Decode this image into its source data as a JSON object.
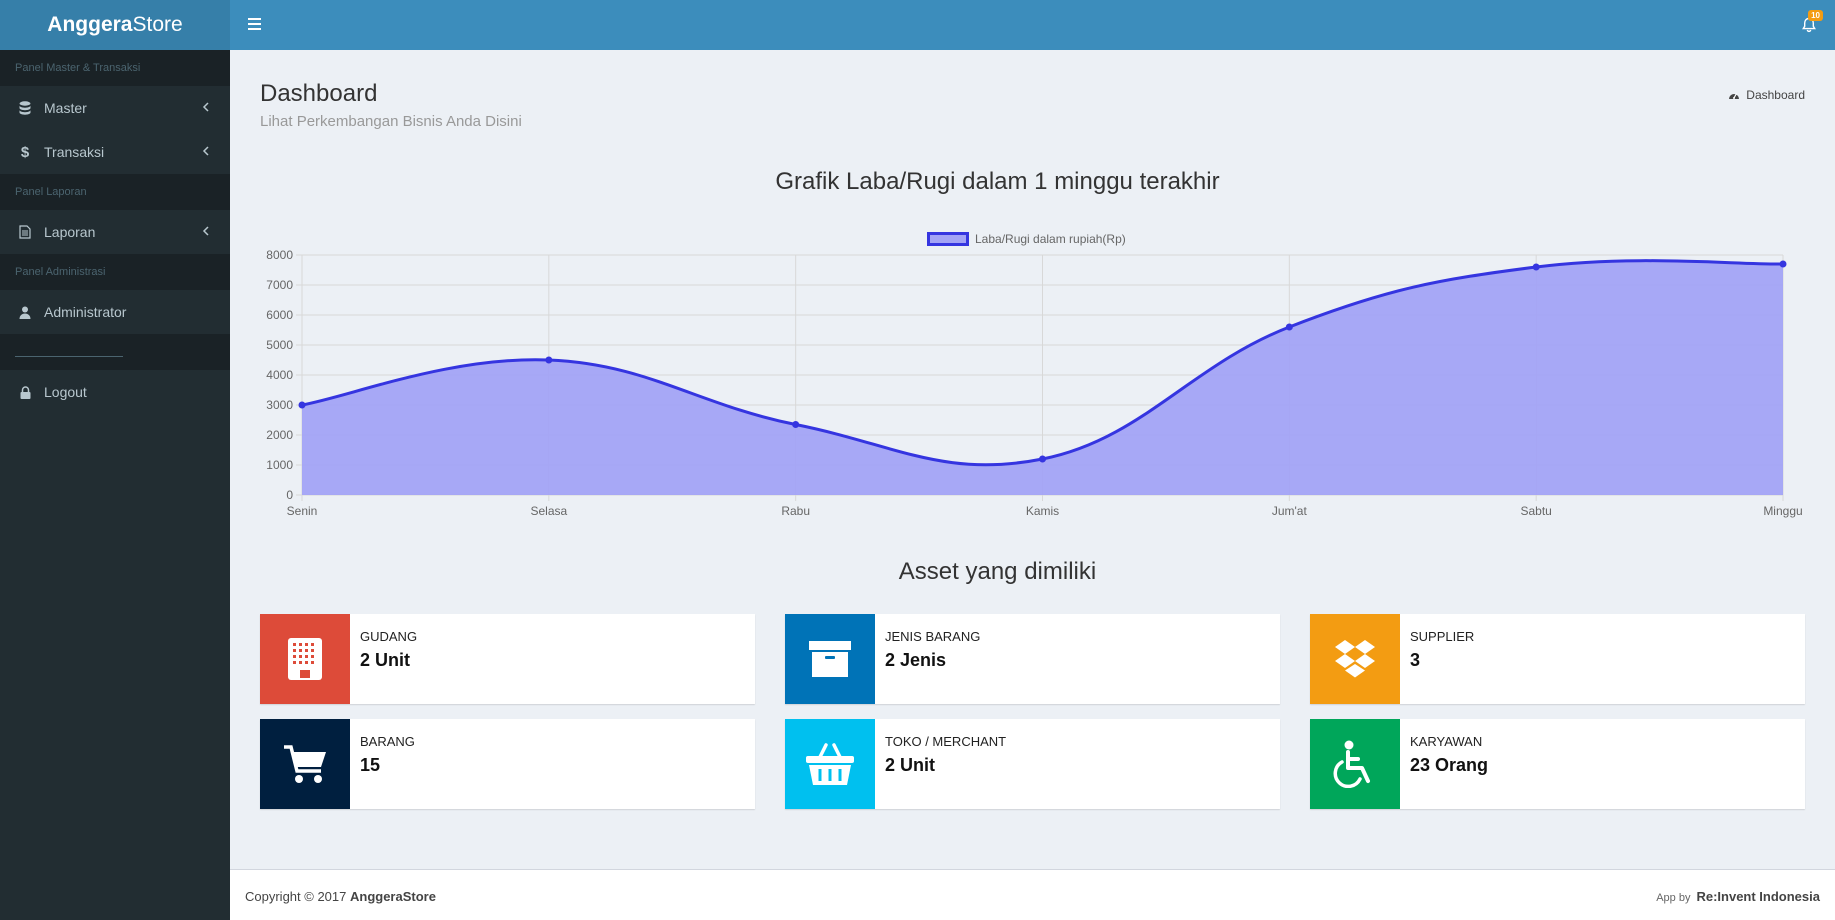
{
  "brand": {
    "bold": "Anggera",
    "light": "Store"
  },
  "notifications": {
    "count": "10"
  },
  "sidebar": {
    "sections": [
      {
        "header": "Panel Master & Transaksi",
        "items": [
          {
            "label": "Master",
            "icon": "database-icon"
          },
          {
            "label": "Transaksi",
            "icon": "dollar-icon"
          }
        ]
      },
      {
        "header": "Panel Laporan",
        "items": [
          {
            "label": "Laporan",
            "icon": "file-text-icon"
          }
        ]
      },
      {
        "header": "Panel Administrasi",
        "items": [
          {
            "label": "Administrator",
            "icon": "user-icon"
          }
        ]
      }
    ],
    "logout": "Logout"
  },
  "page": {
    "title": "Dashboard",
    "subtitle": "Lihat Perkembangan Bisnis Anda Disini",
    "breadcrumb": "Dashboard"
  },
  "chart_title": "Grafik Laba/Rugi dalam 1 minggu terakhir",
  "chart_data": {
    "type": "line",
    "categories": [
      "Senin",
      "Selasa",
      "Rabu",
      "Kamis",
      "Jum'at",
      "Sabtu",
      "Minggu"
    ],
    "series": [
      {
        "name": "Laba/Rugi dalam rupiah(Rp)",
        "values": [
          3000,
          4500,
          2350,
          1200,
          5600,
          7600,
          7700
        ]
      }
    ],
    "ylim": [
      0,
      8000
    ],
    "yticks": [
      0,
      1000,
      2000,
      3000,
      4000,
      5000,
      6000,
      7000,
      8000
    ],
    "fill": true,
    "grid": true,
    "legend": "top-center",
    "line_color": "#3535e0",
    "fill_color": "#a3a3f5"
  },
  "assets_title": "Asset yang dimiliki",
  "assets": [
    {
      "label": "Gudang",
      "value": "2 Unit",
      "color": "#dd4b39",
      "icon": "building-icon"
    },
    {
      "label": "Jenis Barang",
      "value": "2 Jenis",
      "color": "#0073b7",
      "icon": "archive-icon"
    },
    {
      "label": "Supplier",
      "value": "3",
      "color": "#f39c12",
      "icon": "dropbox-icon"
    },
    {
      "label": "Barang",
      "value": "15",
      "color": "#001f3f",
      "icon": "cart-icon"
    },
    {
      "label": "Toko / Merchant",
      "value": "2 Unit",
      "color": "#00c0ef",
      "icon": "basket-icon"
    },
    {
      "label": "Karyawan",
      "value": "23 Orang",
      "color": "#00a65a",
      "icon": "wheelchair-icon"
    }
  ],
  "footer": {
    "copyright": "Copyright © 2017 ",
    "brand": "AnggeraStore",
    "app_by": "App by",
    "company": "Re:Invent Indonesia"
  }
}
